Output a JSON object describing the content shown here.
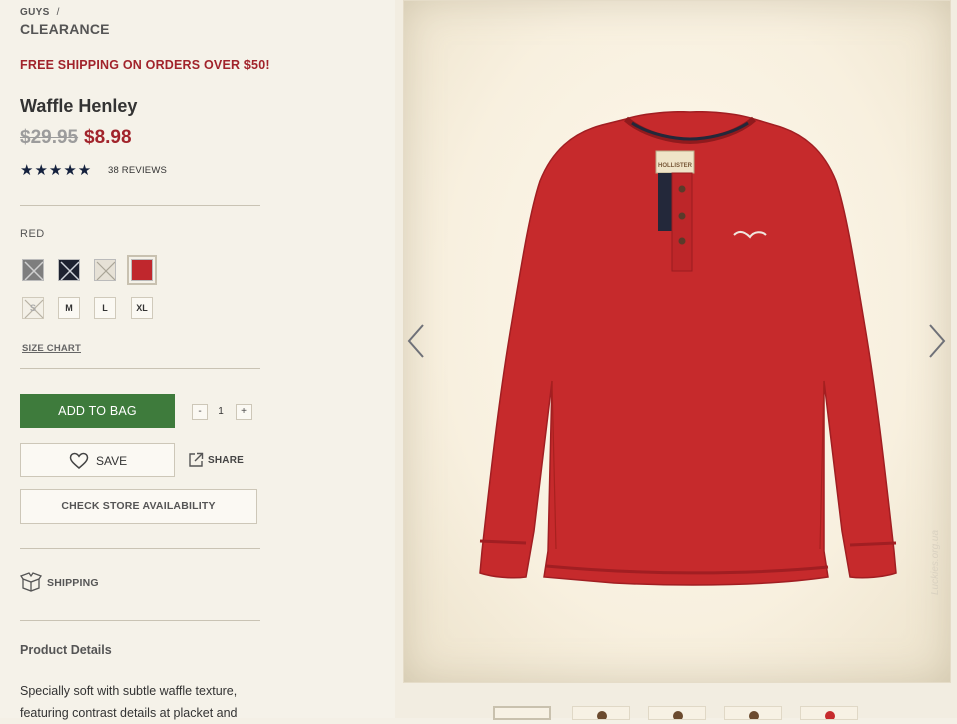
{
  "breadcrumb": {
    "parent": "GUYS",
    "separator": "/",
    "current": "CLEARANCE"
  },
  "promo": "FREE SHIPPING ON ORDERS OVER $50!",
  "product": {
    "title": "Waffle Henley",
    "original_price": "$29.95",
    "sale_price": "$8.98",
    "rating_stars": "★★★★★",
    "rating_value": 5,
    "reviews": "38 REVIEWS"
  },
  "color": {
    "selected_label": "RED",
    "swatches": [
      {
        "name": "grey",
        "hex": "#7e7e7e",
        "available": false
      },
      {
        "name": "navy",
        "hex": "#1d2230",
        "available": false
      },
      {
        "name": "cream",
        "hex": "#e6e1d6",
        "available": false
      },
      {
        "name": "red",
        "hex": "#c0272d",
        "available": true,
        "selected": true
      }
    ]
  },
  "sizes": [
    {
      "label": "S",
      "available": false
    },
    {
      "label": "M",
      "available": true
    },
    {
      "label": "L",
      "available": true
    },
    {
      "label": "XL",
      "available": true
    }
  ],
  "size_chart": "SIZE CHART",
  "actions": {
    "add_to_bag": "ADD TO BAG",
    "qty_minus": "-",
    "qty_value": "1",
    "qty_plus": "+",
    "save": "SAVE",
    "share": "SHARE",
    "check_store": "CHECK STORE AVAILABILITY"
  },
  "shipping": "SHIPPING",
  "details": {
    "title": "Product Details",
    "text": "Specially soft with subtle waffle texture, featuring contrast details at placket and"
  },
  "gallery": {
    "brand_label": "HOLLISTER",
    "watermark": "Luckies.org.ua",
    "thumbnail_count": 5,
    "active_thumbnail": 1
  },
  "colors": {
    "sale_red": "#a1232b",
    "add_green": "#3e7b3c",
    "star_navy": "#14213d",
    "shirt_red": "#c62a2c"
  }
}
